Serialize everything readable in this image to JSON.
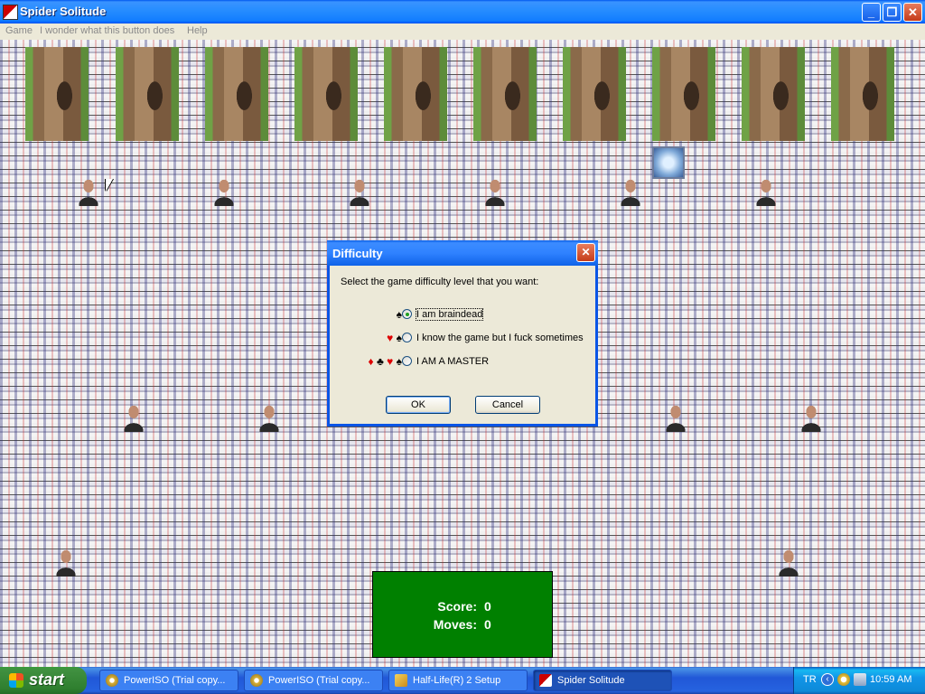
{
  "window": {
    "title": "Spider Solitude",
    "controls": {
      "minimize": "_",
      "maximize": "❐",
      "close": "✕"
    }
  },
  "menu": {
    "items": [
      "Game",
      "I wonder what this button does",
      "Help"
    ]
  },
  "game": {
    "score_label": "Score:",
    "score_value": "0",
    "moves_label": "Moves:",
    "moves_value": "0"
  },
  "dialog": {
    "title": "Difficulty",
    "close": "✕",
    "prompt": "Select the game difficulty level that you want:",
    "options": [
      {
        "label": "I am braindead",
        "suits": [
          "♠"
        ],
        "selected": true
      },
      {
        "label": "I know the game but I fuck sometimes",
        "suits": [
          "♥",
          "♠"
        ],
        "selected": false
      },
      {
        "label": "I AM A MASTER",
        "suits": [
          "♦",
          "♣",
          "♥",
          "♠"
        ],
        "selected": false
      }
    ],
    "ok_label": "OK",
    "cancel_label": "Cancel"
  },
  "taskbar": {
    "start_label": "start",
    "tasks": [
      {
        "label": "PowerISO (Trial copy...",
        "icon": "poweriso-icon"
      },
      {
        "label": "PowerISO (Trial copy...",
        "icon": "poweriso-icon"
      },
      {
        "label": "Half-Life(R) 2 Setup",
        "icon": "halflife-icon"
      },
      {
        "label": "Spider Solitude",
        "icon": "spider-solitaire-icon"
      }
    ],
    "tray": {
      "language": "TR",
      "clock": "10:59 AM"
    }
  }
}
